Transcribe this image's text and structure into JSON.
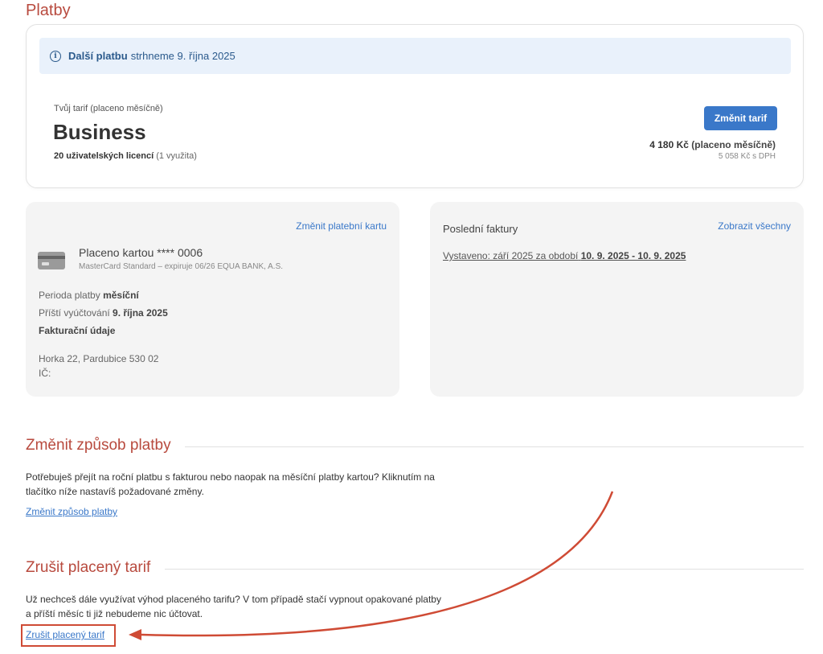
{
  "header": {
    "title": "Platby"
  },
  "notice": {
    "bold": "Další platbu",
    "text": "strhneme 9. října 2025"
  },
  "tariff": {
    "label": "Tvůj tarif (placeno měsíčně)",
    "name": "Business",
    "licenses_bold": "20 uživatelských licencí",
    "licenses_used": "(1 využita)",
    "change_button": "Změnit tarif",
    "price_bold": "4 180 Kč",
    "price_period": "(placeno měsíčně)",
    "price_vat": "5 058 Kč s DPH"
  },
  "payment": {
    "change_card_link": "Změnit platební kartu",
    "card_title": "Placeno kartou **** 0006",
    "card_sub": "MasterCard Standard – expiruje 06/26 EQUA BANK, A.S.",
    "period_label": "Perioda platby",
    "period_value": "měsíční",
    "next_label": "Příští vyúčtování",
    "next_value": "9. října 2025",
    "billing_heading": "Fakturační údaje",
    "address": "Horka 22, Pardubice 530 02",
    "ico": "IČ:"
  },
  "invoices": {
    "title": "Poslední faktury",
    "show_all_link": "Zobrazit všechny",
    "row_text": "Vystaveno: září 2025 za období",
    "row_period": "10. 9. 2025 - 10. 9. 2025"
  },
  "change_method": {
    "title": "Změnit způsob platby",
    "text": "Potřebuješ přejít na roční platbu s fakturou nebo naopak na měsíční platby kartou? Kliknutím na tlačítko níže nastavíš požadované změny.",
    "link": "Změnit způsob platby"
  },
  "cancel": {
    "title": "Zrušit placený tarif",
    "text": "Už nechceš dále využívat výhod placeného tarifu? V tom případě stačí vypnout opakované platby a příští měsíc ti již nebudeme nic účtovat.",
    "link": "Zrušit placený tarif"
  },
  "colors": {
    "accent": "#b84a3e",
    "primary": "#3a78c9",
    "annotation": "#cf4b35"
  }
}
